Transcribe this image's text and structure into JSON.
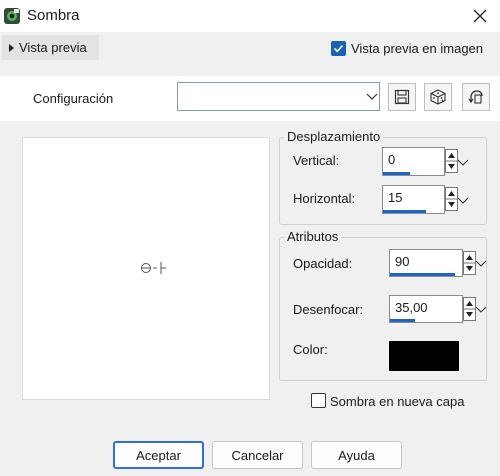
{
  "window": {
    "title": "Sombra",
    "close_icon": "close-icon"
  },
  "preview": {
    "toggle_label": "Vista previa",
    "image_preview_label": "Vista previa en imagen",
    "image_preview_checked": true
  },
  "config": {
    "label": "Configuración",
    "value": "",
    "save_icon": "floppy-save-icon",
    "random_icon": "dice-icon",
    "reset_icon": "reset-preset-icon"
  },
  "offset": {
    "group_title": "Desplazamiento",
    "vertical_label": "Vertical:",
    "vertical_value": "0",
    "vertical_level": 0.45,
    "horizontal_label": "Horizontal:",
    "horizontal_value": "15",
    "horizontal_level": 0.7
  },
  "attributes": {
    "group_title": "Atributos",
    "opacity_label": "Opacidad:",
    "opacity_value": "90",
    "opacity_level": 0.9,
    "blur_label": "Desenfocar:",
    "blur_value": "35,00",
    "blur_level": 0.35,
    "color_label": "Color:",
    "color_value": "#000000"
  },
  "new_layer": {
    "label": "Sombra en nueva capa",
    "checked": false
  },
  "buttons": {
    "ok": "Aceptar",
    "cancel": "Cancelar",
    "help": "Ayuda"
  },
  "colors": {
    "accent": "#1a62b5",
    "slider": "#1e64c8"
  }
}
